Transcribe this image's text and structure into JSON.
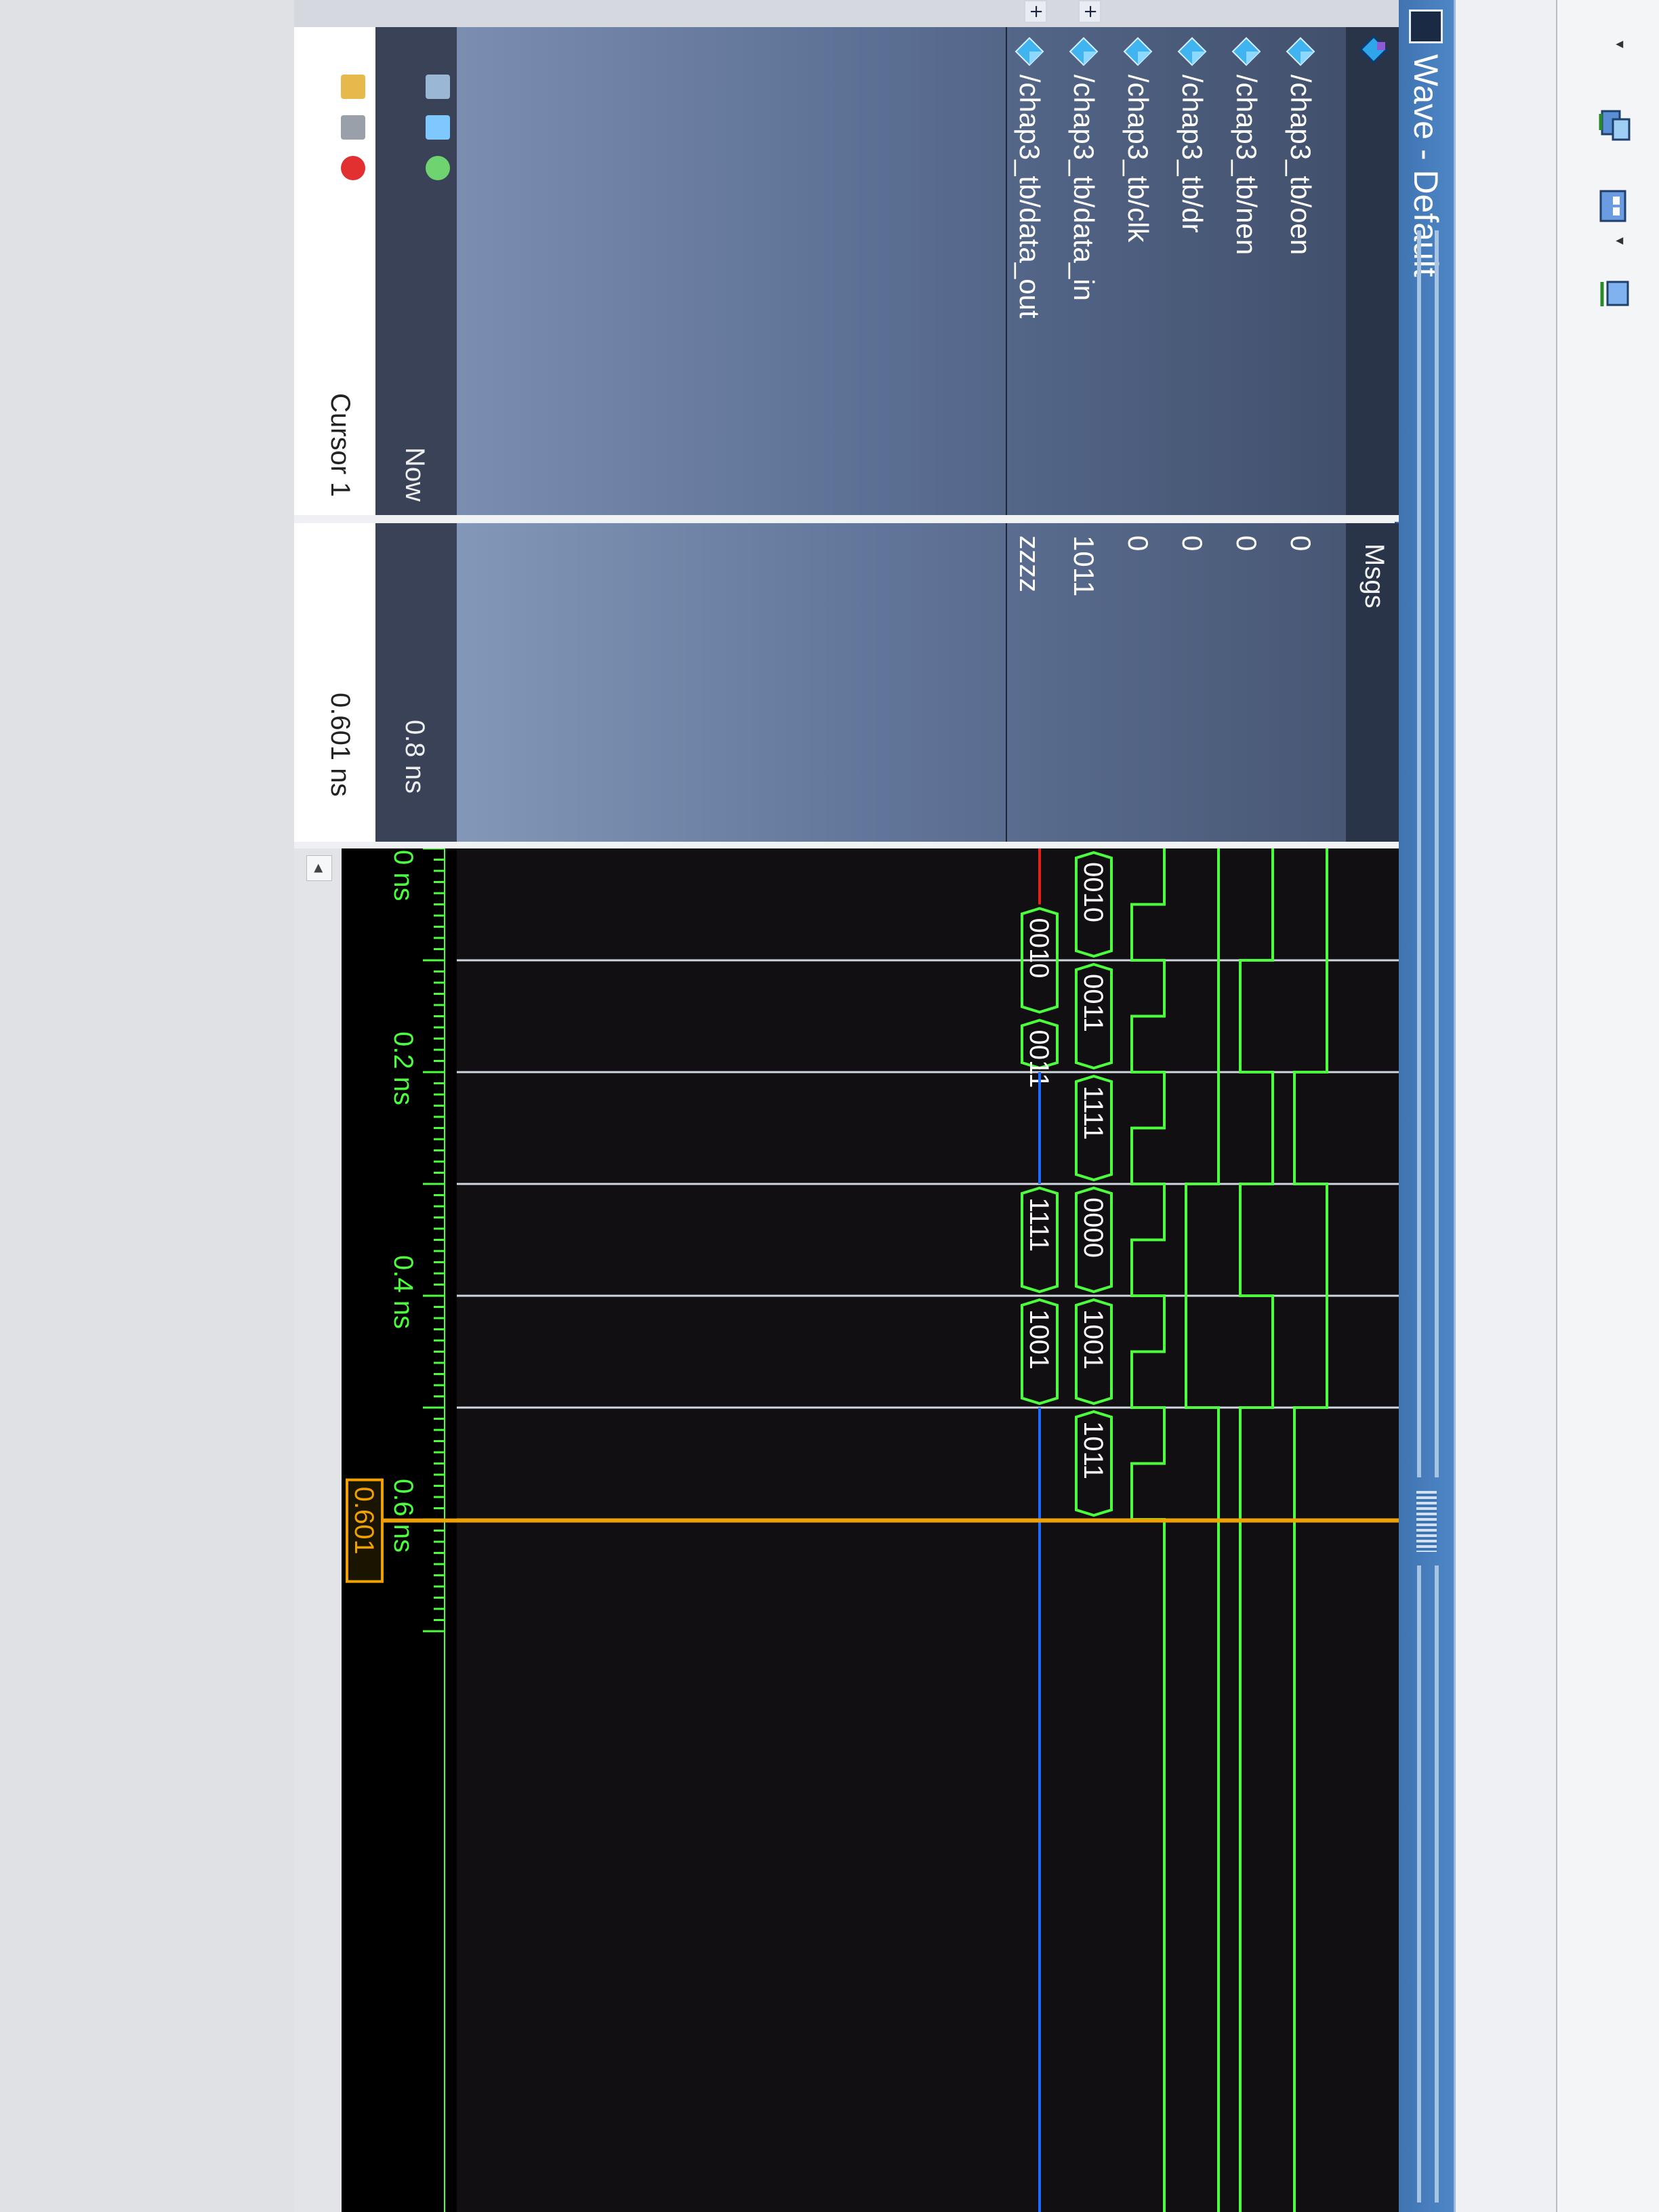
{
  "window": {
    "title": "Wave - Default"
  },
  "toolbar": {
    "icons": [
      "wave-add-icon",
      "wave-format-icon",
      "wave-zoom-icon"
    ]
  },
  "names_pane": {
    "signals": [
      {
        "name": "/chap3_tb/oen",
        "expandable": false
      },
      {
        "name": "/chap3_tb/nen",
        "expandable": false
      },
      {
        "name": "/chap3_tb/dr",
        "expandable": false
      },
      {
        "name": "/chap3_tb/clk",
        "expandable": false
      },
      {
        "name": "/chap3_tb/data_in",
        "expandable": true
      },
      {
        "name": "/chap3_tb/data_out",
        "expandable": true
      }
    ],
    "now_label": "Now",
    "cursor_label": "Cursor 1"
  },
  "values_pane": {
    "header": "Msgs",
    "values": [
      "0",
      "0",
      "0",
      "0",
      "1011",
      "zzzz"
    ],
    "now_value": "0.8 ns",
    "cursor_value": "0.601 ns"
  },
  "waveform": {
    "time_start_label": "0 ns",
    "time_labels": [
      "0.2 ns",
      "0.4 ns",
      "0.6 ns"
    ],
    "cursor_readout": "0.601",
    "data_in_segments": [
      "0010",
      "0011",
      "1111",
      "0000",
      "1001",
      "1011"
    ],
    "data_out_segments": [
      "0010",
      "0011",
      "1111",
      "1001"
    ],
    "colors": {
      "wave": "#4cff3c",
      "bus_text": "#ffffff",
      "cursor": "#f0a000",
      "grid": "#cfd6de",
      "timeline_text": "#4cff3c",
      "x_value": "#e8201c",
      "z_value": "#1d6cff"
    }
  }
}
